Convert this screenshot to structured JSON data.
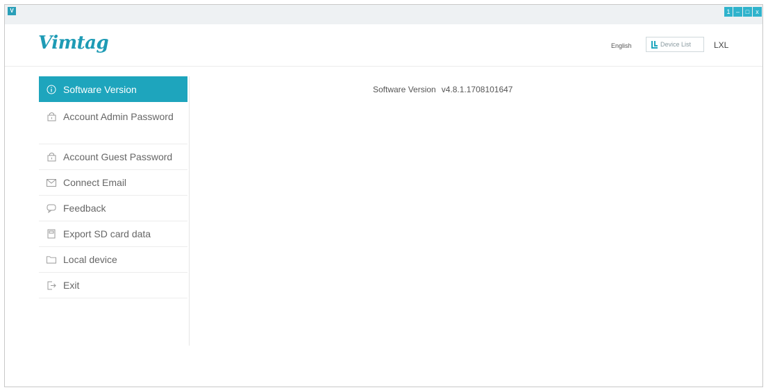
{
  "titlebar": {
    "app_icon": "vimtag-app-icon",
    "badge_text": "1",
    "controls": [
      {
        "name": "info-button",
        "label": "1"
      },
      {
        "name": "minimize-button",
        "label": "–"
      },
      {
        "name": "maximize-button",
        "label": "□"
      },
      {
        "name": "close-button",
        "label": "x"
      }
    ]
  },
  "header": {
    "logo": "Vimtag",
    "language": "English",
    "device_list": "Device List",
    "user": "LXL"
  },
  "sidebar": {
    "items": [
      {
        "label": "Software Version",
        "icon": "info-icon",
        "active": true
      },
      {
        "label": "Account Admin Password",
        "icon": "lock-icon",
        "active": false
      },
      {
        "label": "Account Guest Password",
        "icon": "lock-icon",
        "active": false
      },
      {
        "label": "Connect Email",
        "icon": "email-icon",
        "active": false
      },
      {
        "label": "Feedback",
        "icon": "chat-icon",
        "active": false
      },
      {
        "label": "Export SD card data",
        "icon": "sd-card-icon",
        "active": false
      },
      {
        "label": "Local device",
        "icon": "folder-icon",
        "active": false
      },
      {
        "label": "Exit",
        "icon": "exit-icon",
        "active": false
      }
    ]
  },
  "main": {
    "software_version_label": "Software Version",
    "software_version_value": "v4.8.1.1708101647"
  },
  "colors": {
    "accent": "#1ea5bd",
    "logo": "#1e9bb5"
  }
}
